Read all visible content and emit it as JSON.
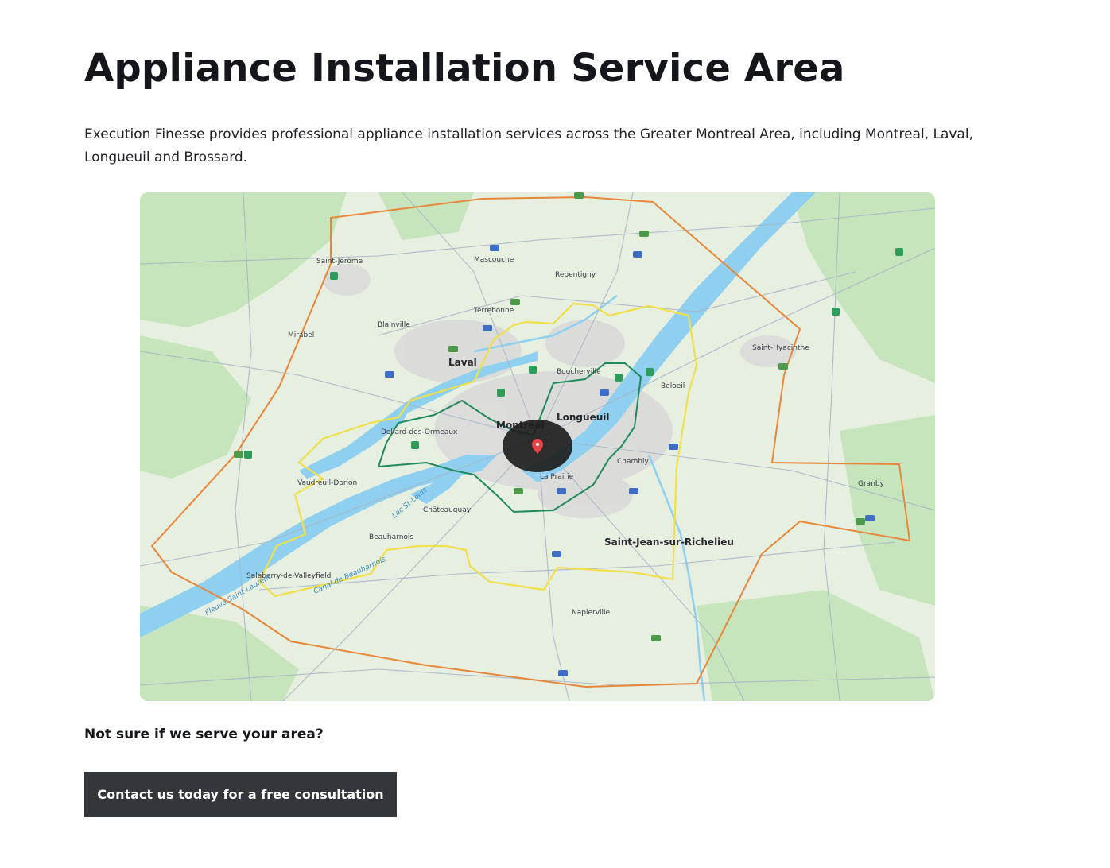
{
  "page": {
    "title": "Appliance Installation Service Area",
    "description": "Execution Finesse provides professional appliance installation services across the Greater Montreal Area, including Montreal, Laval, Longueuil and Brossard.",
    "question": "Not sure if we serve your area?",
    "cta_label": "Contact us today for a free consultation"
  },
  "map": {
    "labels": {
      "laval": "Laval",
      "montreal": "Montréal",
      "longueuil": "Longueuil",
      "st_jean": "Saint-Jean-sur-Richelieu",
      "st_jerome": "Saint-Jérôme",
      "terrebonne": "Terrebonne",
      "mascouche": "Mascouche",
      "repentigny": "Repentigny",
      "boucherville": "Boucherville",
      "chambly": "Chambly",
      "la_prairie": "La Prairie",
      "chateauguay": "Châteauguay",
      "vaudreuil": "Vaudreuil-Dorion",
      "dollard": "Dollard-des-Ormeaux",
      "beloeil": "Beloeil",
      "st_hyacinthe": "Saint-Hyacinthe",
      "granby": "Granby",
      "mirabel": "Mirabel",
      "blainville": "Blainville",
      "salaberry": "Salaberry-de-Valleyfield",
      "beauharnois": "Beauharnois",
      "napierville": "Napierville",
      "lac_st_louis": "Lac St-Louis",
      "fleuve": "Fleuve Saint-Laurent",
      "canal": "Canal de Beauharnois"
    },
    "colors": {
      "land": "#e9f0e4",
      "forest": "#c9e6c0",
      "water": "#8fd0f0",
      "urban": "#dcdcdc",
      "outer_zone": "#e8873a",
      "middle_zone": "#f0e04a",
      "inner_zone": "#1f8a5a",
      "pin_bubble": "#1e1e1e",
      "pin": "#e8424a"
    }
  }
}
